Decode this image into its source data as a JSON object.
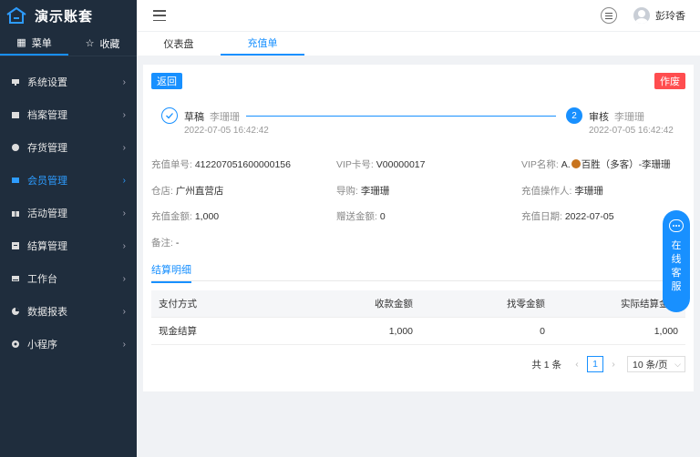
{
  "app": {
    "title": "演示账套"
  },
  "sidebar": {
    "tabs": [
      {
        "label": "菜单",
        "icon": "grid-icon"
      },
      {
        "label": "收藏",
        "icon": "star-icon"
      }
    ],
    "items": [
      {
        "label": "系统设置",
        "icon": "monitor-icon"
      },
      {
        "label": "档案管理",
        "icon": "folder-icon"
      },
      {
        "label": "存货管理",
        "icon": "box-icon"
      },
      {
        "label": "会员管理",
        "icon": "member-card-icon"
      },
      {
        "label": "活动管理",
        "icon": "gift-icon"
      },
      {
        "label": "结算管理",
        "icon": "settle-icon"
      },
      {
        "label": "工作台",
        "icon": "desk-icon"
      },
      {
        "label": "数据报表",
        "icon": "pie-icon"
      },
      {
        "label": "小程序",
        "icon": "mini-app-icon"
      }
    ],
    "active_color": "#2d9cff"
  },
  "header": {
    "username": "彭玲香"
  },
  "page_tabs": [
    {
      "label": "仪表盘"
    },
    {
      "label": "充值单"
    }
  ],
  "actions": {
    "back": "返回",
    "void": "作废"
  },
  "steps": {
    "s1": {
      "title": "草稿",
      "user": "李珊珊",
      "time": "2022-07-05 16:42:42"
    },
    "s2": {
      "num": "2",
      "title": "审核",
      "user": "李珊珊",
      "time": "2022-07-05 16:42:42"
    }
  },
  "info": {
    "order_no_label": "充值单号:",
    "order_no": "412207051600000156",
    "vip_card_label": "VIP卡号:",
    "vip_card": "V00000017",
    "vip_name_label": "VIP名称:",
    "vip_name_prefix": "A.",
    "vip_name_rest": "百胜（多客）-李珊珊",
    "store_label": "仓店:",
    "store": "广州直营店",
    "guide_label": "导购:",
    "guide": "李珊珊",
    "operator_label": "充值操作人:",
    "operator": "李珊珊",
    "amount_label": "充值金额:",
    "amount": "1,000",
    "gift_label": "赠送金额:",
    "gift": "0",
    "date_label": "充值日期:",
    "date": "2022-07-05",
    "remark_label": "备注:",
    "remark": "-"
  },
  "section": {
    "title": "结算明细"
  },
  "table": {
    "headers": [
      "支付方式",
      "收款金额",
      "找零金额",
      "实际结算金额"
    ],
    "rows": [
      [
        "现金结算",
        "1,000",
        "0",
        "1,000"
      ]
    ]
  },
  "pager": {
    "total": "共 1 条",
    "page": "1",
    "size": "10 条/页"
  },
  "service": {
    "chars": [
      "在",
      "线",
      "客",
      "服"
    ]
  },
  "colors": {
    "primary": "#1890ff",
    "danger": "#ff4d4f",
    "sidebar_bg": "#1f2d3d"
  }
}
